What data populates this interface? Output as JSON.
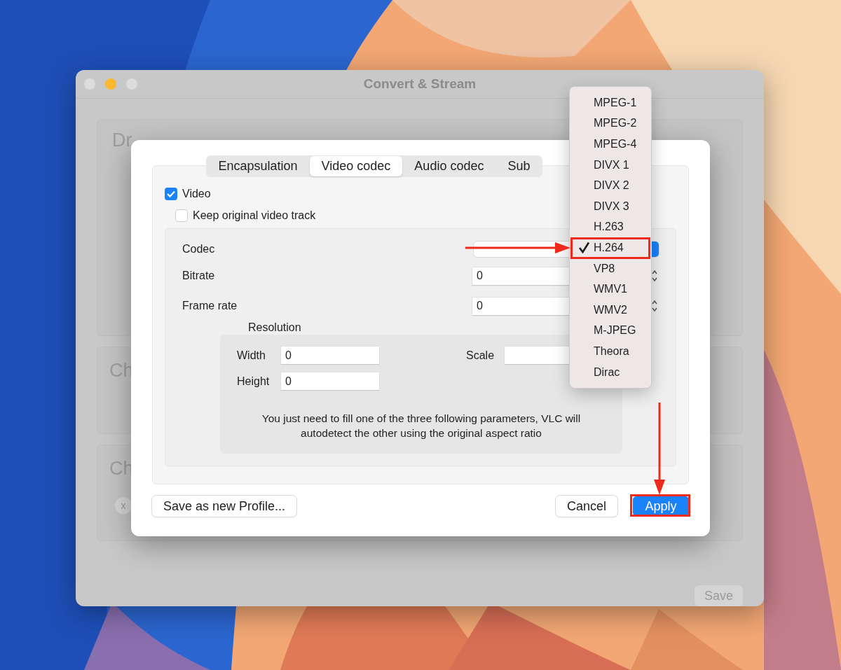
{
  "window": {
    "title": "Convert & Stream",
    "panels": [
      "Dr",
      "Ch",
      "Ch"
    ],
    "remove_button": "x",
    "save_button": "Save"
  },
  "dialog": {
    "tabs": [
      {
        "label": "Encapsulation",
        "selected": false
      },
      {
        "label": "Video codec",
        "selected": true
      },
      {
        "label": "Audio codec",
        "selected": false
      },
      {
        "label": "Sub",
        "selected": false
      }
    ],
    "video": {
      "label": "Video",
      "checked": true
    },
    "keep_original": {
      "label": "Keep original video track",
      "checked": false
    },
    "codec": {
      "label": "Codec"
    },
    "bitrate": {
      "label": "Bitrate",
      "value": "0"
    },
    "frame_rate": {
      "label": "Frame rate",
      "value": "0"
    },
    "resolution": {
      "title": "Resolution",
      "width": {
        "label": "Width",
        "value": "0"
      },
      "height": {
        "label": "Height",
        "value": "0"
      },
      "scale": {
        "label": "Scale"
      },
      "note": "You just need to fill one of the three following parameters, VLC will autodetect the other using the original aspect ratio"
    },
    "buttons": {
      "save_profile": "Save as new Profile...",
      "cancel": "Cancel",
      "apply": "Apply"
    }
  },
  "codec_menu": {
    "items": [
      {
        "label": "MPEG-1",
        "selected": false
      },
      {
        "label": "MPEG-2",
        "selected": false
      },
      {
        "label": "MPEG-4",
        "selected": false
      },
      {
        "label": "DIVX 1",
        "selected": false
      },
      {
        "label": "DIVX 2",
        "selected": false
      },
      {
        "label": "DIVX 3",
        "selected": false
      },
      {
        "label": "H.263",
        "selected": false
      },
      {
        "label": "H.264",
        "selected": true
      },
      {
        "label": "VP8",
        "selected": false
      },
      {
        "label": "WMV1",
        "selected": false
      },
      {
        "label": "WMV2",
        "selected": false
      },
      {
        "label": "M-JPEG",
        "selected": false
      },
      {
        "label": "Theora",
        "selected": false
      },
      {
        "label": "Dirac",
        "selected": false
      }
    ]
  }
}
